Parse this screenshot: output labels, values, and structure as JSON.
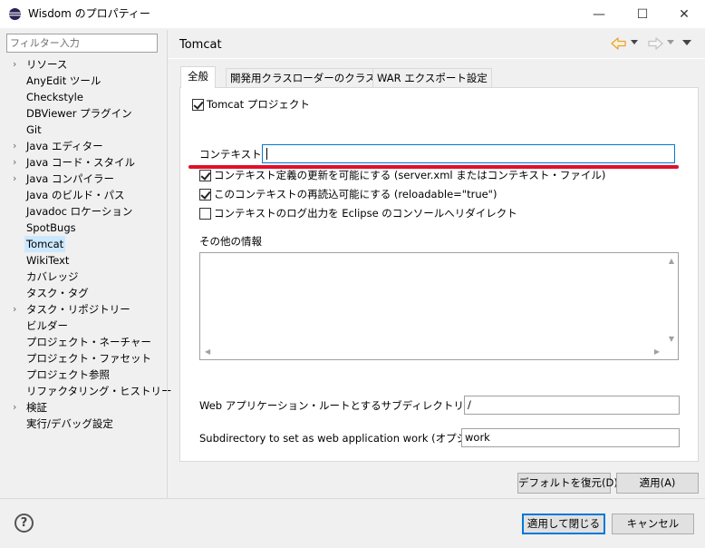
{
  "window": {
    "title": "Wisdom のプロパティー",
    "minimize": "—",
    "maximize": "☐",
    "close": "✕"
  },
  "sidebar": {
    "filter_placeholder": "フィルター入力",
    "items": [
      {
        "label": "リソース",
        "expandable": true
      },
      {
        "label": "AnyEdit ツール",
        "expandable": false
      },
      {
        "label": "Checkstyle",
        "expandable": false
      },
      {
        "label": "DBViewer プラグイン",
        "expandable": false
      },
      {
        "label": "Git",
        "expandable": false
      },
      {
        "label": "Java エディター",
        "expandable": true
      },
      {
        "label": "Java コード・スタイル",
        "expandable": true
      },
      {
        "label": "Java コンパイラー",
        "expandable": true
      },
      {
        "label": "Java のビルド・パス",
        "expandable": false
      },
      {
        "label": "Javadoc ロケーション",
        "expandable": false
      },
      {
        "label": "SpotBugs",
        "expandable": false
      },
      {
        "label": "Tomcat",
        "expandable": false,
        "selected": true
      },
      {
        "label": "WikiText",
        "expandable": false
      },
      {
        "label": "カバレッジ",
        "expandable": false
      },
      {
        "label": "タスク・タグ",
        "expandable": false
      },
      {
        "label": "タスク・リポジトリー",
        "expandable": true
      },
      {
        "label": "ビルダー",
        "expandable": false
      },
      {
        "label": "プロジェクト・ネーチャー",
        "expandable": false
      },
      {
        "label": "プロジェクト・ファセット",
        "expandable": false
      },
      {
        "label": "プロジェクト参照",
        "expandable": false
      },
      {
        "label": "リファクタリング・ヒストリー",
        "expandable": false
      },
      {
        "label": "検証",
        "expandable": true
      },
      {
        "label": "実行/デバッグ設定",
        "expandable": false
      }
    ]
  },
  "page": {
    "title": "Tomcat",
    "tabs": [
      {
        "label": "全般",
        "active": true
      },
      {
        "label": "開発用クラスローダーのクラスパス",
        "active": false
      },
      {
        "label": "WAR エクスポート設定",
        "active": false
      }
    ],
    "tomcat_project": {
      "label": "Tomcat プロジェクト",
      "checked": true
    },
    "context_name": {
      "label": "コンテキスト名",
      "value": ""
    },
    "options": [
      {
        "label": "コンテキスト定義の更新を可能にする (server.xml またはコンテキスト・ファイル)",
        "checked": true
      },
      {
        "label": "このコンテキストの再読込可能にする (reloadable=\"true\")",
        "checked": true
      },
      {
        "label": "コンテキストのログ出力を Eclipse のコンソールへリダイレクト",
        "checked": false
      }
    ],
    "other_info": {
      "label": "その他の情報",
      "value": ""
    },
    "web_root": {
      "label": "Web アプリケーション・ルートとするサブディレクトリー (オプション)",
      "value": "/"
    },
    "work_dir": {
      "label": "Subdirectory to set as web application work (オプション)",
      "value": "work"
    },
    "restore_defaults": "デフォルトを復元(D)",
    "apply": "適用(A)"
  },
  "footer": {
    "help": "?",
    "apply_close": "適用して閉じる",
    "cancel": "キャンセル"
  },
  "colors": {
    "accent": "#0078d7",
    "selection": "#cce8ff",
    "highlight_line": "#e0102a",
    "nav_back": "#e8a33b"
  }
}
